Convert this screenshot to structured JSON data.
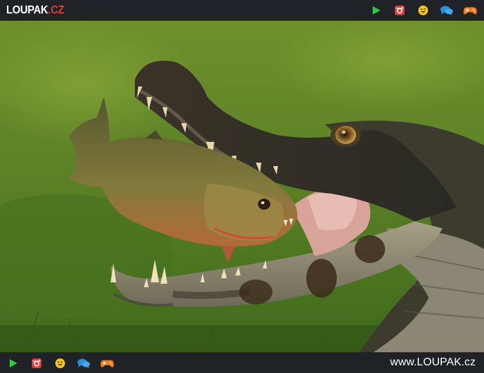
{
  "header": {
    "logo_main": "LOUPAK",
    "logo_dot": ".",
    "logo_tld": "CZ",
    "icons": [
      {
        "name": "play-icon",
        "color": "#2ecc40"
      },
      {
        "name": "instagram-icon",
        "color": "#e53935"
      },
      {
        "name": "smiley-icon",
        "color": "#f5c518"
      },
      {
        "name": "chat-icon",
        "color": "#2a8fd8"
      },
      {
        "name": "gamepad-icon",
        "color": "#f57c20"
      }
    ]
  },
  "photo": {
    "subject": "caiman-eating-piranha-photo"
  },
  "footer": {
    "site_url": "www.LOUPAK.cz",
    "icons": [
      {
        "name": "play-icon",
        "color": "#2ecc40"
      },
      {
        "name": "instagram-icon",
        "color": "#e53935"
      },
      {
        "name": "smiley-icon",
        "color": "#f5c518"
      },
      {
        "name": "chat-icon",
        "color": "#2a8fd8"
      },
      {
        "name": "gamepad-icon",
        "color": "#f57c20"
      }
    ]
  },
  "colors": {
    "bar_bg": "#1f2226",
    "accent_red": "#e53935",
    "grass": "#5f8a2a"
  }
}
